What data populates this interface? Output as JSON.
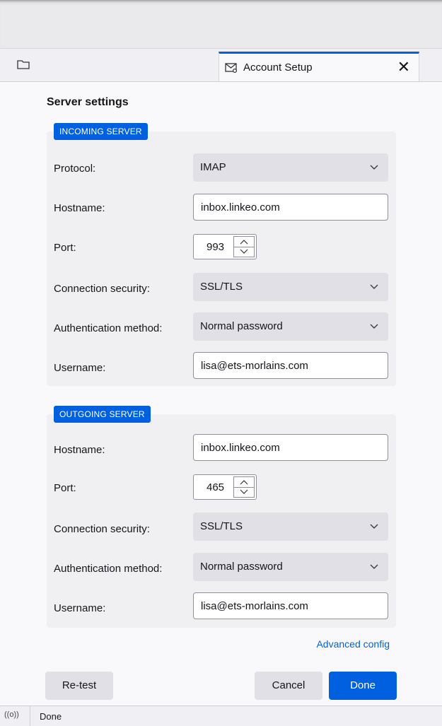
{
  "window": {
    "tab_title": "Account Setup",
    "tab_icon": "mail-settings-icon"
  },
  "page": {
    "section_title": "Server settings"
  },
  "incoming": {
    "badge": "INCOMING SERVER",
    "protocol_label": "Protocol:",
    "protocol_value": "IMAP",
    "hostname_label": "Hostname:",
    "hostname_value": "inbox.linkeo.com",
    "port_label": "Port:",
    "port_value": "993",
    "security_label": "Connection security:",
    "security_value": "SSL/TLS",
    "auth_label": "Authentication method:",
    "auth_value": "Normal password",
    "username_label": "Username:",
    "username_value": "lisa@ets-morlains.com"
  },
  "outgoing": {
    "badge": "OUTGOING SERVER",
    "hostname_label": "Hostname:",
    "hostname_value": "inbox.linkeo.com",
    "port_label": "Port:",
    "port_value": "465",
    "security_label": "Connection security:",
    "security_value": "SSL/TLS",
    "auth_label": "Authentication method:",
    "auth_value": "Normal password",
    "username_label": "Username:",
    "username_value": "lisa@ets-morlains.com"
  },
  "links": {
    "advanced_config": "Advanced config"
  },
  "buttons": {
    "retest": "Re-test",
    "cancel": "Cancel",
    "done": "Done"
  },
  "status": {
    "icon": "((o))",
    "text": "Done"
  },
  "colors": {
    "accent": "#0060df",
    "panel": "#f0f0f3",
    "select_bg": "#e0e0e6"
  }
}
